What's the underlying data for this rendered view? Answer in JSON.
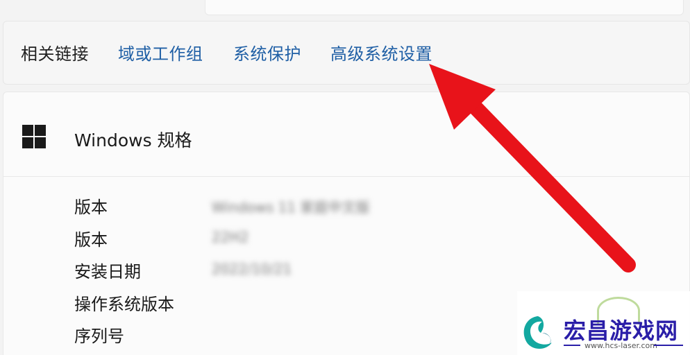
{
  "related": {
    "label": "相关链接",
    "links": [
      "域或工作组",
      "系统保护",
      "高级系统设置"
    ]
  },
  "spec": {
    "title": "Windows 规格",
    "rows": [
      {
        "label": "版本",
        "value": "Windows 11 家庭中文版"
      },
      {
        "label": "版本",
        "value": "22H2"
      },
      {
        "label": "安装日期",
        "value": "2022/10/21"
      },
      {
        "label": "操作系统版本",
        "value": ""
      },
      {
        "label": "序列号",
        "value": ""
      }
    ]
  },
  "watermark": {
    "title": "宏昌游戏网",
    "url": "www.hcs-laser.com"
  },
  "colors": {
    "link": "#1f5fa5",
    "arrow": "#e8131a",
    "watermark_text": "#2a1ea8"
  },
  "icons": [
    "windows-logo-icon",
    "chevron-up-icon",
    "red-arrow-annotation"
  ]
}
